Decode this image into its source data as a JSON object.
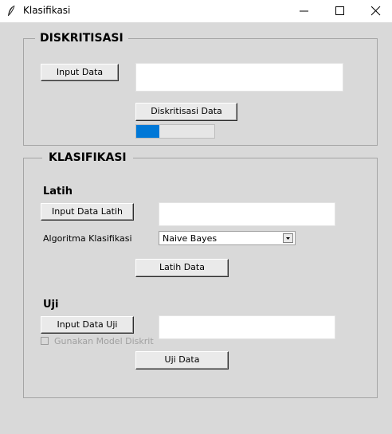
{
  "window": {
    "title": "Klasifikasi",
    "icon": "feather-icon",
    "controls": [
      "minimize-icon",
      "maximize-icon",
      "close-icon"
    ]
  },
  "diskritisasi": {
    "group_title": "DISKRITISASI",
    "input_button": "Input Data",
    "input_value": "",
    "action_button": "Diskritisasi Data",
    "progress_fraction": 0.3,
    "progress_color": "#0078d7"
  },
  "klasifikasi": {
    "group_title": "KLASIFIKASI",
    "latih": {
      "section_label": "Latih",
      "input_button": "Input Data Latih",
      "input_value": "",
      "algorithm_label": "Algoritma Klasifikasi",
      "algorithm_selected": "Naive Bayes",
      "action_button": "Latih Data"
    },
    "uji": {
      "section_label": "Uji",
      "input_button": "Input Data Uji",
      "input_value": "",
      "checkbox_label": "Gunakan Model Diskrit",
      "checkbox_checked": false,
      "action_button": "Uji Data"
    }
  }
}
